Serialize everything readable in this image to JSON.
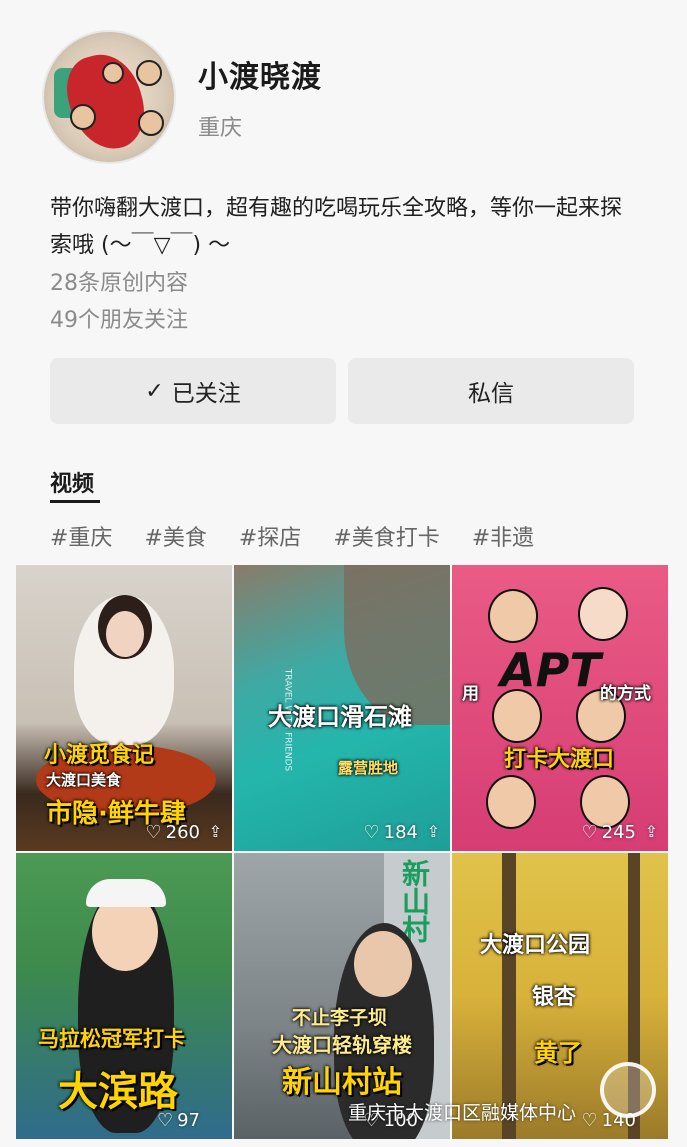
{
  "profile": {
    "nickname": "小渡晓渡",
    "location": "重庆",
    "bio": "带你嗨翻大渡口，超有趣的吃喝玩乐全攻略，等你一起来探索哦 (～￣▽￣) ～",
    "original_count": "28条原创内容",
    "friends_following": "49个朋友关注"
  },
  "actions": {
    "follow_icon": "✓",
    "follow_label": "已关注",
    "message_label": "私信"
  },
  "section": {
    "title": "视频"
  },
  "tags": [
    "#重庆",
    "#美食",
    "#探店",
    "#美食打卡",
    "#非遗"
  ],
  "videos": [
    {
      "texts": [
        "小渡觅食记",
        "大渡口美食",
        "市隐·鲜牛肆"
      ],
      "likes": "260"
    },
    {
      "texts": [
        "大渡口滑石滩",
        "露营胜地",
        "TRAVEL WITH FRIENDS"
      ],
      "likes": "184"
    },
    {
      "texts": [
        "用",
        "APT",
        "的方式",
        "打卡大渡口"
      ],
      "likes": "245"
    },
    {
      "texts": [
        "马拉松冠军打卡",
        "大滨路"
      ],
      "likes": "97"
    },
    {
      "texts": [
        "不止李子坝",
        "大渡口轻轨穿楼",
        "新山村站",
        "新山村"
      ],
      "likes": "100"
    },
    {
      "texts": [
        "大渡口公园",
        "银杏",
        "黄了"
      ],
      "likes": "140"
    }
  ],
  "watermark": "重庆市大渡口区融媒体中心",
  "icons": {
    "heart": "heart-icon",
    "share": "share-icon",
    "check": "check-icon"
  }
}
